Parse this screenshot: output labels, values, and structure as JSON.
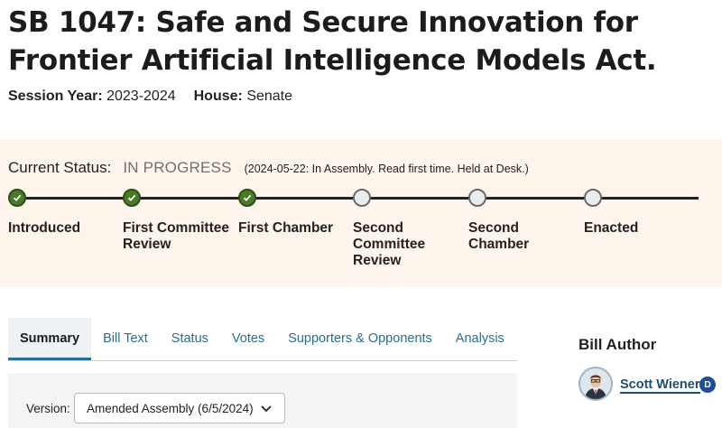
{
  "bill": {
    "title": "SB 1047: Safe and Secure Innovation for Frontier Artificial Intelligence Models Act.",
    "session_label": "Session Year:",
    "session_value": "2023-2024",
    "house_label": "House:",
    "house_value": "Senate"
  },
  "status": {
    "label": "Current Status:",
    "value": "IN PROGRESS",
    "note": "(2024-05-22: In Assembly. Read first time. Held at Desk.)",
    "steps": [
      {
        "label": "Introduced",
        "done": true
      },
      {
        "label": "First Committee Review",
        "done": true
      },
      {
        "label": "First Chamber",
        "done": true
      },
      {
        "label": "Second Committee Review",
        "done": false
      },
      {
        "label": "Second Chamber",
        "done": false
      },
      {
        "label": "Enacted",
        "done": false
      }
    ],
    "colors": {
      "done": "#4a7a2a",
      "todo": "#ececec",
      "panel_bg": "#fdf5ec"
    }
  },
  "tabs": [
    {
      "label": "Summary",
      "active": true
    },
    {
      "label": "Bill Text",
      "active": false
    },
    {
      "label": "Status",
      "active": false
    },
    {
      "label": "Votes",
      "active": false
    },
    {
      "label": "Supporters & Opponents",
      "active": false
    },
    {
      "label": "Analysis",
      "active": false
    }
  ],
  "version": {
    "label": "Version:",
    "selected": "Amended Assembly (6/5/2024)",
    "icon": "chevron-down-icon"
  },
  "author": {
    "heading": "Bill Author",
    "name": "Scott Wiener",
    "party": "D",
    "party_color": "#1f4f9a",
    "link_color": "#1f4f6e"
  }
}
